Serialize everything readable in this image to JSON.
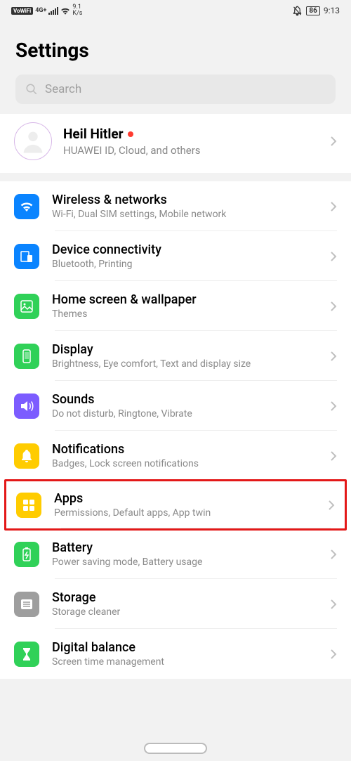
{
  "status": {
    "vowifi": "VoWiFi",
    "net_type": "4G+",
    "speed_top": "9.1",
    "speed_bottom": "K/s",
    "battery": "86",
    "time": "9:13"
  },
  "header": {
    "title": "Settings"
  },
  "search": {
    "placeholder": "Search"
  },
  "account": {
    "name": "Heil Hitler",
    "subtitle": "HUAWEI ID, Cloud, and others"
  },
  "items": [
    {
      "title": "Wireless & networks",
      "subtitle": "Wi-Fi, Dual SIM settings, Mobile network",
      "color": "bg-blue",
      "icon": "wifi",
      "highlight": false
    },
    {
      "title": "Device connectivity",
      "subtitle": "Bluetooth, Printing",
      "color": "bg-teal",
      "icon": "devices",
      "highlight": false
    },
    {
      "title": "Home screen & wallpaper",
      "subtitle": "Themes",
      "color": "bg-green",
      "icon": "image",
      "highlight": false
    },
    {
      "title": "Display",
      "subtitle": "Brightness, Eye comfort, Text and display size",
      "color": "bg-green",
      "icon": "phone",
      "highlight": false
    },
    {
      "title": "Sounds",
      "subtitle": "Do not disturb, Ringtone, Vibrate",
      "color": "bg-purple",
      "icon": "sound",
      "highlight": false
    },
    {
      "title": "Notifications",
      "subtitle": "Badges, Lock screen notifications",
      "color": "bg-yellow",
      "icon": "bell",
      "highlight": false
    },
    {
      "title": "Apps",
      "subtitle": "Permissions, Default apps, App twin",
      "color": "bg-yellow",
      "icon": "apps",
      "highlight": true
    },
    {
      "title": "Battery",
      "subtitle": "Power saving mode, Battery usage",
      "color": "bg-green",
      "icon": "battery",
      "highlight": false
    },
    {
      "title": "Storage",
      "subtitle": "Storage cleaner",
      "color": "bg-gray",
      "icon": "storage",
      "highlight": false
    },
    {
      "title": "Digital balance",
      "subtitle": "Screen time management",
      "color": "bg-green",
      "icon": "hourglass",
      "highlight": false
    }
  ]
}
